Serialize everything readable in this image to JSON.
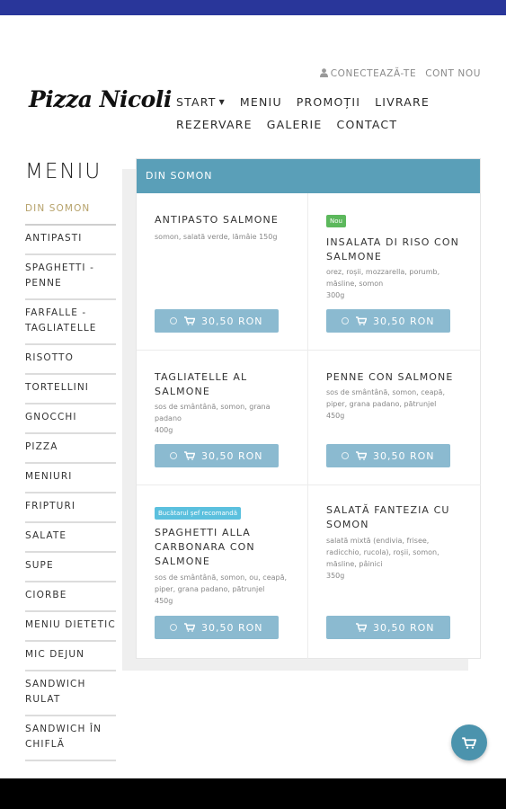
{
  "account": {
    "login": "CONECTEAZĂ-TE",
    "register": "CONT NOU"
  },
  "logo": "Pizza Nicoli",
  "nav": [
    "START",
    "MENIU",
    "PROMOȚII",
    "LIVRARE",
    "REZERVARE",
    "GALERIE",
    "CONTACT"
  ],
  "sidebar": {
    "title": "MENIU",
    "items": [
      "DIN SOMON",
      "ANTIPASTI",
      "SPAGHETTI - PENNE",
      "FARFALLE - TAGLIATELLE",
      "RISOTTO",
      "TORTELLINI",
      "GNOCCHI",
      "PIZZA",
      "MENIURI",
      "FRIPTURI",
      "SALATE",
      "SUPE",
      "CIORBE",
      "MENIU DIETETIC",
      "MIC DEJUN",
      "SANDWICH RULAT",
      "SANDWICH ÎN CHIFLĂ"
    ]
  },
  "content": {
    "header": "DIN SOMON",
    "products": [
      {
        "name": "ANTIPASTO SALMONE",
        "badge": "",
        "desc": "somon, salată verde, lămâie 150g",
        "price": "30,50 RON"
      },
      {
        "name": "INSALATA DI RISO CON SALMONE",
        "badge": "Nou",
        "desc": "orez, roșii, mozzarella, porumb, măsline, somon",
        "weight": "300g",
        "price": "30,50 RON"
      },
      {
        "name": "TAGLIATELLE AL SALMONE",
        "badge": "",
        "desc": "sos de smântână, somon, grana padano",
        "weight": "400g",
        "price": "30,50 RON"
      },
      {
        "name": "PENNE CON SALMONE",
        "badge": "",
        "desc": "sos de smântână, somon, ceapă, piper, grana padano, pătrunjel",
        "weight": "450g",
        "price": "30,50 RON"
      },
      {
        "name": "SPAGHETTI ALLA CARBONARA CON SALMONE",
        "badge": "Bucătarul șef recomandă",
        "desc": "sos de smântână, somon, ou, ceapă, piper, grana padano, pătrunjel",
        "weight": "450g",
        "price": "30,50 RON"
      },
      {
        "name": "SALATĂ FANTEZIA CU SOMON",
        "badge": "",
        "desc": "salată mixtă (endivia, frisee, radicchio, rucola), roșii, somon, măsline, pâinici",
        "weight": "350g",
        "price": "30,50 RON"
      }
    ]
  },
  "colors": {
    "header": "#5a9fb8",
    "button": "#8bbad0",
    "active": "#b6a26a",
    "fab": "#4b93ad",
    "status_bar": "#29369a"
  },
  "icons": {
    "user": "user-icon",
    "cart": "cart-icon",
    "spinner": "spinner-icon"
  }
}
